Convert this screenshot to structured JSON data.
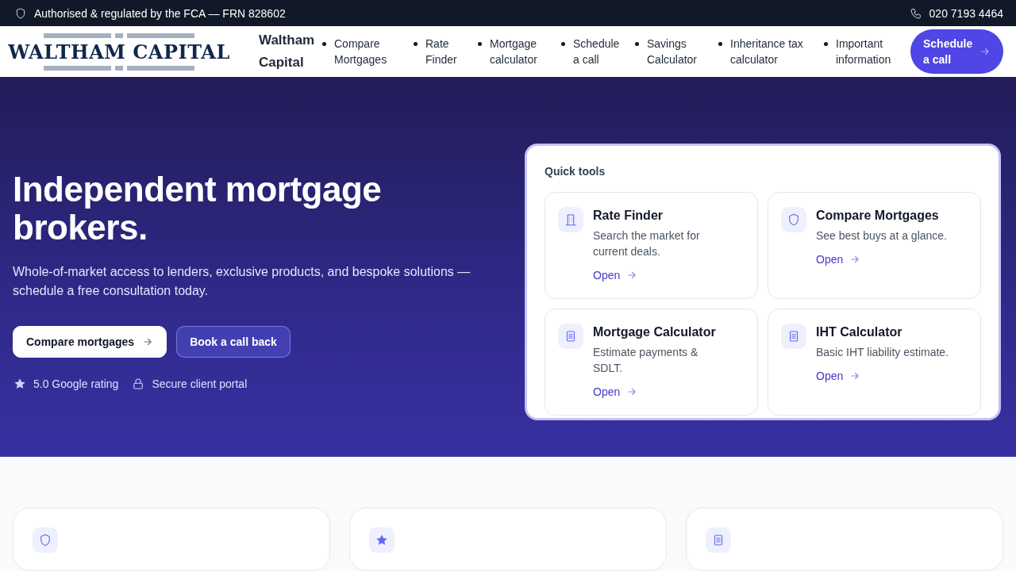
{
  "top_bar": {
    "notice": "Authorised & regulated by the FCA — FRN 828602",
    "phone": "020 7193 4464"
  },
  "header": {
    "logo": "WALTHAM CAPITAL",
    "brand": "Waltham Capital",
    "nav": [
      "Compare Mortgages",
      "Rate Finder",
      "Mortgage calculator",
      "Schedule a call",
      "Savings Calculator",
      "Inheritance tax calculator",
      "Important information"
    ],
    "cta": "Schedule a call"
  },
  "hero": {
    "title": "Independent mortgage brokers.",
    "subtitle": "Whole-of-market access to lenders, exclusive products, and bespoke solutions — schedule a free consultation today.",
    "buttons": [
      {
        "label": "Compare mortgages",
        "kind": "primary"
      },
      {
        "label": "Book a call back",
        "kind": "secondary"
      }
    ],
    "badges": [
      {
        "kind": "star",
        "label": "5.0 Google rating"
      },
      {
        "kind": "lock",
        "label": "Secure client portal"
      }
    ]
  },
  "quick_tools": {
    "title": "Quick tools",
    "tools": [
      {
        "kind": "building",
        "title": "Rate Finder",
        "description": "Search the market for current deals.",
        "link": "Open"
      },
      {
        "kind": "shield",
        "title": "Compare Mortgages",
        "description": "See best buys at a glance.",
        "link": "Open"
      },
      {
        "kind": "document",
        "title": "Mortgage Calculator",
        "description": "Estimate payments & SDLT.",
        "link": "Open"
      },
      {
        "kind": "document",
        "title": "IHT Calculator",
        "description": "Basic IHT liability estimate.",
        "link": "Open"
      }
    ]
  },
  "feature_cards": [
    {
      "kind": "shield"
    },
    {
      "kind": "star"
    },
    {
      "kind": "document"
    }
  ]
}
